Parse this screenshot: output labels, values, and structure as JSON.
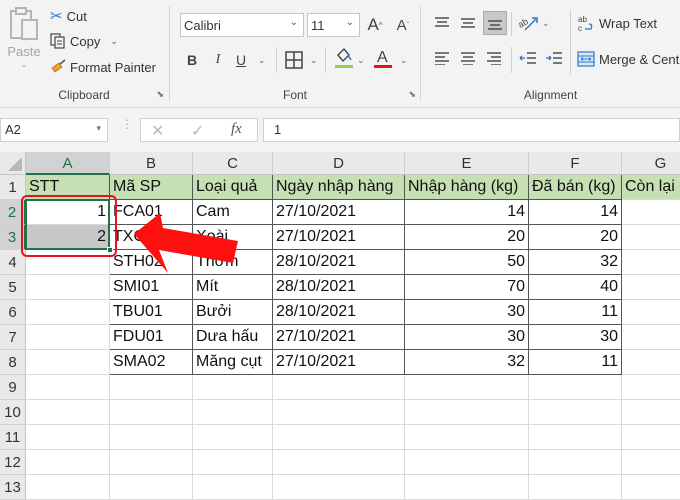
{
  "ribbon": {
    "clipboard": {
      "label": "Clipboard",
      "paste": "Paste",
      "cut": "Cut",
      "copy": "Copy",
      "format_painter": "Format Painter"
    },
    "font": {
      "label": "Font",
      "font_name": "Calibri",
      "font_size": "11",
      "bold": "B",
      "italic": "I",
      "underline": "U",
      "font_color_hex": "#e81123",
      "fill_color_hex": "#92d050"
    },
    "alignment": {
      "label": "Alignment",
      "wrap_text": "Wrap Text",
      "merge_center": "Merge & Cent"
    }
  },
  "formula_bar": {
    "name_box": "A2",
    "fx": "fx",
    "value": "1"
  },
  "sheet": {
    "columns": [
      "A",
      "B",
      "C",
      "D",
      "E",
      "F",
      "G"
    ],
    "selected_column": "A",
    "rows": [
      "1",
      "2",
      "3",
      "4",
      "5",
      "6",
      "7",
      "8",
      "9",
      "10",
      "11",
      "12",
      "13"
    ],
    "selected_rows": [
      "2",
      "3"
    ],
    "header": [
      "STT",
      "Mã SP",
      "Loại quả",
      "Ngày nhập hàng",
      "Nhập hàng (kg)",
      "Đã bán (kg)",
      "Còn lại"
    ],
    "data": [
      [
        "1",
        "FCA01",
        "Cam",
        "27/10/2021",
        "14",
        "14",
        ""
      ],
      [
        "2",
        "TXO01",
        "Xoài",
        "27/10/2021",
        "20",
        "20",
        ""
      ],
      [
        "",
        "STH02",
        "Thơm",
        "28/10/2021",
        "50",
        "32",
        ""
      ],
      [
        "",
        "SMI01",
        "Mít",
        "28/10/2021",
        "70",
        "40",
        ""
      ],
      [
        "",
        "TBU01",
        "Bưởi",
        "28/10/2021",
        "30",
        "11",
        ""
      ],
      [
        "",
        "FDU01",
        "Dưa hấu",
        "27/10/2021",
        "30",
        "30",
        ""
      ],
      [
        "",
        "SMA02",
        "Măng cụt",
        "27/10/2021",
        "32",
        "11",
        ""
      ]
    ],
    "header_fill_hex": "#c6e0b4",
    "selection_hex": "#217346"
  },
  "annotation": {
    "highlight_color_hex": "#e81123",
    "arrow_color_hex": "#ff1010"
  }
}
